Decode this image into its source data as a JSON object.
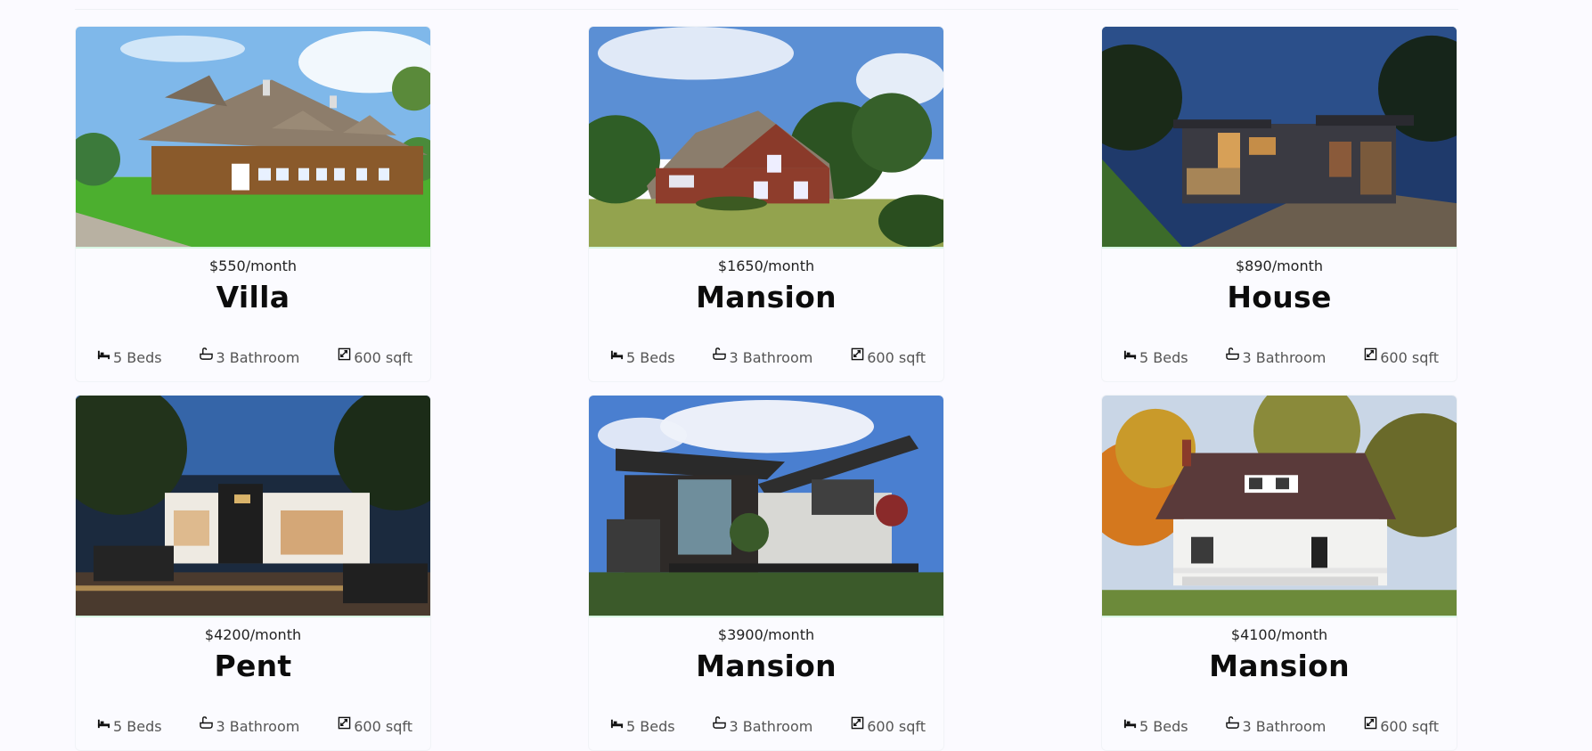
{
  "listings": [
    {
      "price": "$550/month",
      "title": "Villa",
      "beds": "5 Beds",
      "baths": "3 Bathroom",
      "area": "600 sqft",
      "photo": "thatched-cottage"
    },
    {
      "price": "$1650/month",
      "title": "Mansion",
      "beds": "5 Beds",
      "baths": "3 Bathroom",
      "area": "600 sqft",
      "photo": "brick-house"
    },
    {
      "price": "$890/month",
      "title": "House",
      "beds": "5 Beds",
      "baths": "3 Bathroom",
      "area": "600 sqft",
      "photo": "modern-night-house"
    },
    {
      "price": "$4200/month",
      "title": "Pent",
      "beds": "5 Beds",
      "baths": "3 Bathroom",
      "area": "600 sqft",
      "photo": "restaurant-night"
    },
    {
      "price": "$3900/month",
      "title": "Mansion",
      "beds": "5 Beds",
      "baths": "3 Bathroom",
      "area": "600 sqft",
      "photo": "modern-glass-house"
    },
    {
      "price": "$4100/month",
      "title": "Mansion",
      "beds": "5 Beds",
      "baths": "3 Bathroom",
      "area": "600 sqft",
      "photo": "autumn-bungalow"
    }
  ],
  "icons": {
    "beds": "bed-icon",
    "baths": "bathtub-icon",
    "area": "area-icon"
  },
  "colors": {
    "background": "#fbfaff",
    "accent_border": "#d8f5e2"
  }
}
